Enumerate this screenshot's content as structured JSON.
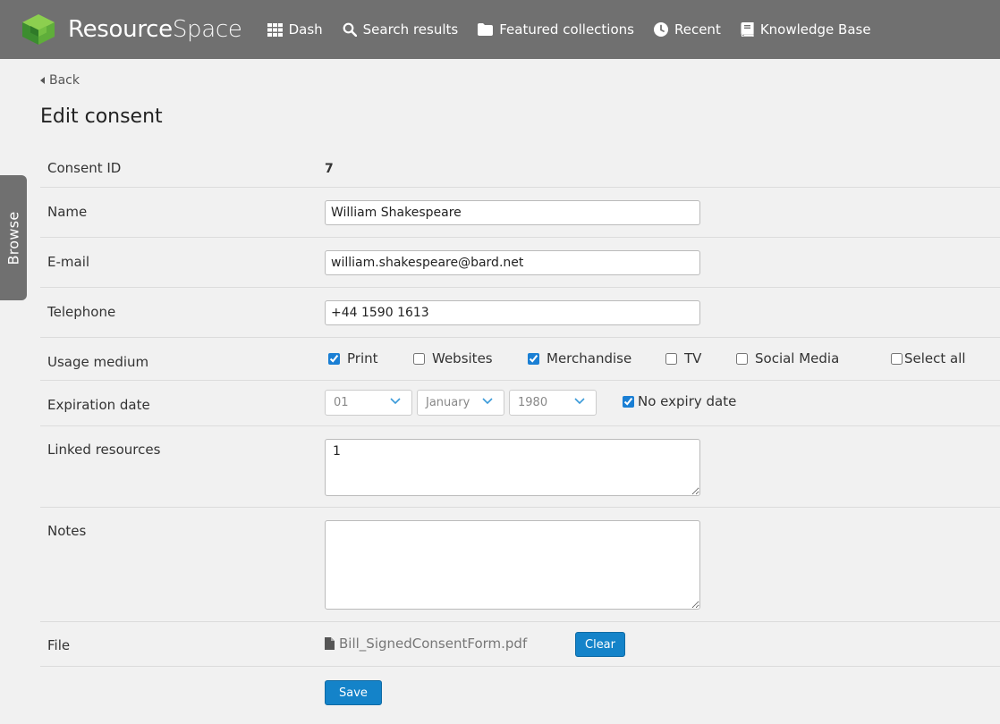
{
  "header": {
    "logo_text_bold": "Resource",
    "logo_text_thin": "Space",
    "nav": [
      {
        "label": "Dash",
        "icon": "grid-icon"
      },
      {
        "label": "Search results",
        "icon": "search-icon"
      },
      {
        "label": "Featured collections",
        "icon": "folder-icon"
      },
      {
        "label": "Recent",
        "icon": "clock-icon"
      },
      {
        "label": "Knowledge Base",
        "icon": "book-icon"
      }
    ]
  },
  "browse_tab": "Browse",
  "back_label": "Back",
  "page_title": "Edit consent",
  "form": {
    "consent_id_label": "Consent ID",
    "consent_id_value": "7",
    "name_label": "Name",
    "name_value": "William Shakespeare",
    "email_label": "E-mail",
    "email_value": "william.shakespeare@bard.net",
    "telephone_label": "Telephone",
    "telephone_value": "+44 1590 1613",
    "usage_label": "Usage medium",
    "usage_options": [
      {
        "label": "Print",
        "checked": true
      },
      {
        "label": "Websites",
        "checked": false
      },
      {
        "label": "Merchandise",
        "checked": true
      },
      {
        "label": "TV",
        "checked": false
      },
      {
        "label": "Social Media",
        "checked": false
      }
    ],
    "select_all_label": "Select all",
    "expiry_label": "Expiration date",
    "expiry_day": "01",
    "expiry_month": "January",
    "expiry_year": "1980",
    "no_expiry_label": "No expiry date",
    "no_expiry_checked": true,
    "linked_label": "Linked resources",
    "linked_value": "1",
    "notes_label": "Notes",
    "notes_value": "",
    "file_label": "File",
    "file_name": "Bill_SignedConsentForm.pdf",
    "clear_label": "Clear",
    "save_label": "Save"
  },
  "colors": {
    "header_bg": "#707070",
    "button_blue": "#1483c9",
    "page_bg": "#f1f1f1"
  }
}
